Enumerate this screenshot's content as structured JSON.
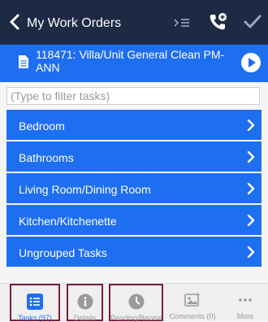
{
  "header": {
    "title": "My Work Orders"
  },
  "work_order": {
    "title": "118471: Villa/Unit General Clean PM-ANN"
  },
  "filter": {
    "placeholder": "(Type to filter tasks)"
  },
  "tasks": [
    {
      "label": "Bedroom"
    },
    {
      "label": "Bathrooms"
    },
    {
      "label": "Living Room/Dining Room"
    },
    {
      "label": "Kitchen/Kitchenette"
    },
    {
      "label": "Ungrouped Tasks"
    }
  ],
  "tabs": [
    {
      "label": "Tasks (97)",
      "icon": "list-icon"
    },
    {
      "label": "Details",
      "icon": "info-icon"
    },
    {
      "label": "Pending/Recent",
      "icon": "clock-icon"
    },
    {
      "label": "Comments (0)",
      "icon": "image-comment-icon"
    },
    {
      "label": "More",
      "icon": "more-dots-icon"
    }
  ],
  "colors": {
    "header_bg": "#1e2a44",
    "accent_blue": "#1e6ef0",
    "highlight_box": "#7a1e34",
    "tab_inactive": "#9a9a9a"
  }
}
